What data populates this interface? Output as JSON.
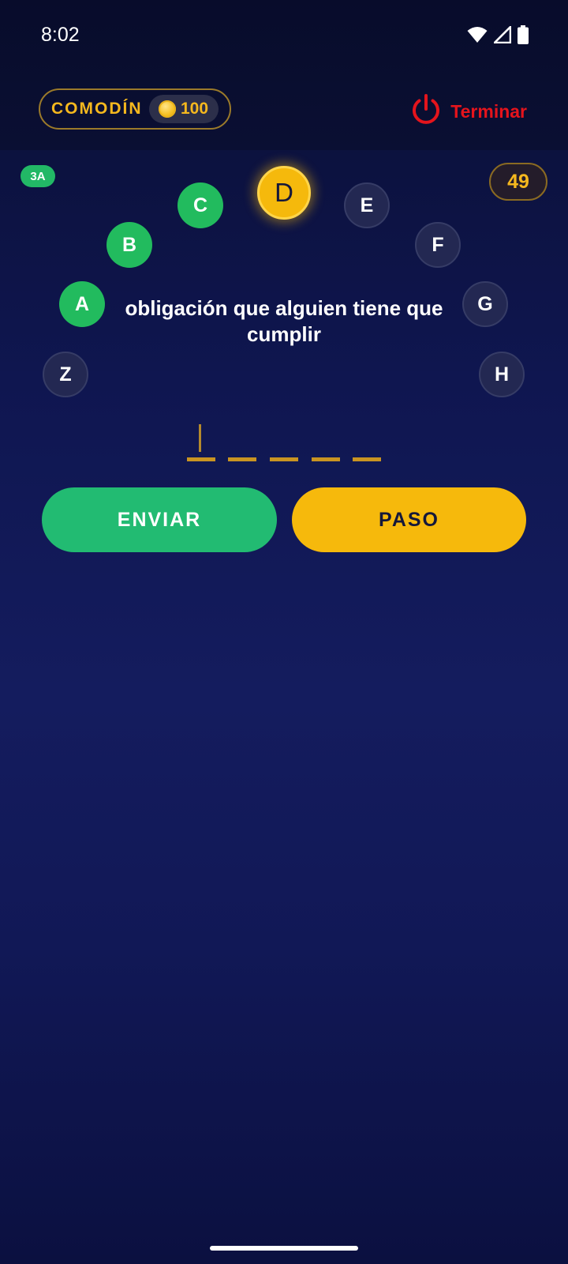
{
  "status_bar": {
    "time": "8:02",
    "icons": [
      "wifi-icon",
      "signal-icon",
      "battery-icon"
    ]
  },
  "header": {
    "comodin_label": "COMODÍN",
    "coins": "100",
    "coin_icon": "coin-icon",
    "end_label": "Terminar",
    "end_icon": "power-icon"
  },
  "game": {
    "level_badge": "3A",
    "counter": "49",
    "letters": [
      {
        "letter": "A",
        "state": "done"
      },
      {
        "letter": "B",
        "state": "done"
      },
      {
        "letter": "C",
        "state": "done"
      },
      {
        "letter": "D",
        "state": "current"
      },
      {
        "letter": "E",
        "state": "pending"
      },
      {
        "letter": "F",
        "state": "pending"
      },
      {
        "letter": "G",
        "state": "pending"
      },
      {
        "letter": "H",
        "state": "pending"
      },
      {
        "letter": "Z",
        "state": "pending"
      }
    ],
    "question": "obligación que alguien tiene que cumplir",
    "answer_slots": 5
  },
  "actions": {
    "send_label": "ENVIAR",
    "pass_label": "PASO"
  },
  "colors": {
    "accent_gold": "#f5b81e",
    "done_green": "#22bb5e",
    "end_red": "#e5141c"
  }
}
